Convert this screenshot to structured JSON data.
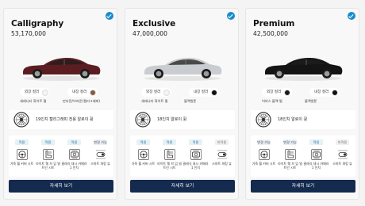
{
  "cards": [
    {
      "name": "Calligraphy",
      "price": "53,170,000",
      "car_color": "#5c1d22",
      "exterior_label": "외장 컬러",
      "interior_label": "내장 컬러",
      "exterior_swatch": "#f7f4ee",
      "interior_swatch": "#8a5a3b",
      "exterior_name": "세레니티 화이트 펄",
      "interior_name": "만다린/브라운(캘리그래피)",
      "wheel": "19인치 캘리그래피 전용 알로이 휠",
      "options": [
        {
          "badge": "적용",
          "badge_style": "green",
          "label": "가죽 휠 커버 시트"
        },
        {
          "badge": "적용",
          "badge_style": "green",
          "label": "라이트 웨 브 임 빌트인 시트"
        },
        {
          "badge": "적용",
          "badge_style": "green",
          "label": "클래식 대시 카메라 1 인치"
        },
        {
          "badge": "변경 가능",
          "badge_style": "blue",
          "label": "스마트 파킹 뷰"
        }
      ],
      "cta": "자세히 보기"
    },
    {
      "name": "Exclusive",
      "price": "47,000,000",
      "car_color": "#c9ccd0",
      "exterior_label": "외장 컬러",
      "interior_label": "내장 컬러",
      "exterior_swatch": "#f7f4ee",
      "interior_swatch": "#111111",
      "exterior_name": "세레니티 화이트 펄",
      "interior_name": "블랙원톤",
      "wheel": "18인치 알로이 휠",
      "options": [
        {
          "badge": "적용",
          "badge_style": "green",
          "label": "가죽 휠 커버 시트"
        },
        {
          "badge": "적용",
          "badge_style": "green",
          "label": "라이트 웨 브 임 빌트인 시트"
        },
        {
          "badge": "적용",
          "badge_style": "green",
          "label": "클래식 대시 카메라 1 인치"
        },
        {
          "badge": "미적용",
          "badge_style": "gray",
          "label": "스마트 파킹 뷰"
        }
      ],
      "cta": "자세히 보기"
    },
    {
      "name": "Premium",
      "price": "42,500,000",
      "car_color": "#141414",
      "exterior_label": "외장 컬러",
      "interior_label": "내장 컬러",
      "exterior_swatch": "#1a1a1a",
      "interior_swatch": "#111111",
      "exterior_name": "어비스 블랙 펄",
      "interior_name": "블랙원톤",
      "wheel": "18인치 알로이 휠",
      "options": [
        {
          "badge": "변경 가능",
          "badge_style": "blue",
          "label": "가죽 휠 커버 시트"
        },
        {
          "badge": "변경 가능",
          "badge_style": "blue",
          "label": "라이트 웨 브 임 빌트인 시트"
        },
        {
          "badge": "적용",
          "badge_style": "green",
          "label": "클래식 대시 카메라 1 인치"
        },
        {
          "badge": "미적용",
          "badge_style": "gray",
          "label": "스마트 파킹 뷰"
        }
      ],
      "cta": "자세히 보기"
    }
  ],
  "icons": {
    "selected": "checkmark-circle-icon",
    "wheel": "alloy-wheel-icon",
    "options": [
      "steering-wheel-icon",
      "seat-icon",
      "dash-camera-icon",
      "parking-view-icon"
    ]
  },
  "colors": {
    "accent": "#1a8ccc",
    "cta_background": "#152a4f",
    "card_background": "#f8f8f8",
    "page_background": "#f4f4f4"
  }
}
